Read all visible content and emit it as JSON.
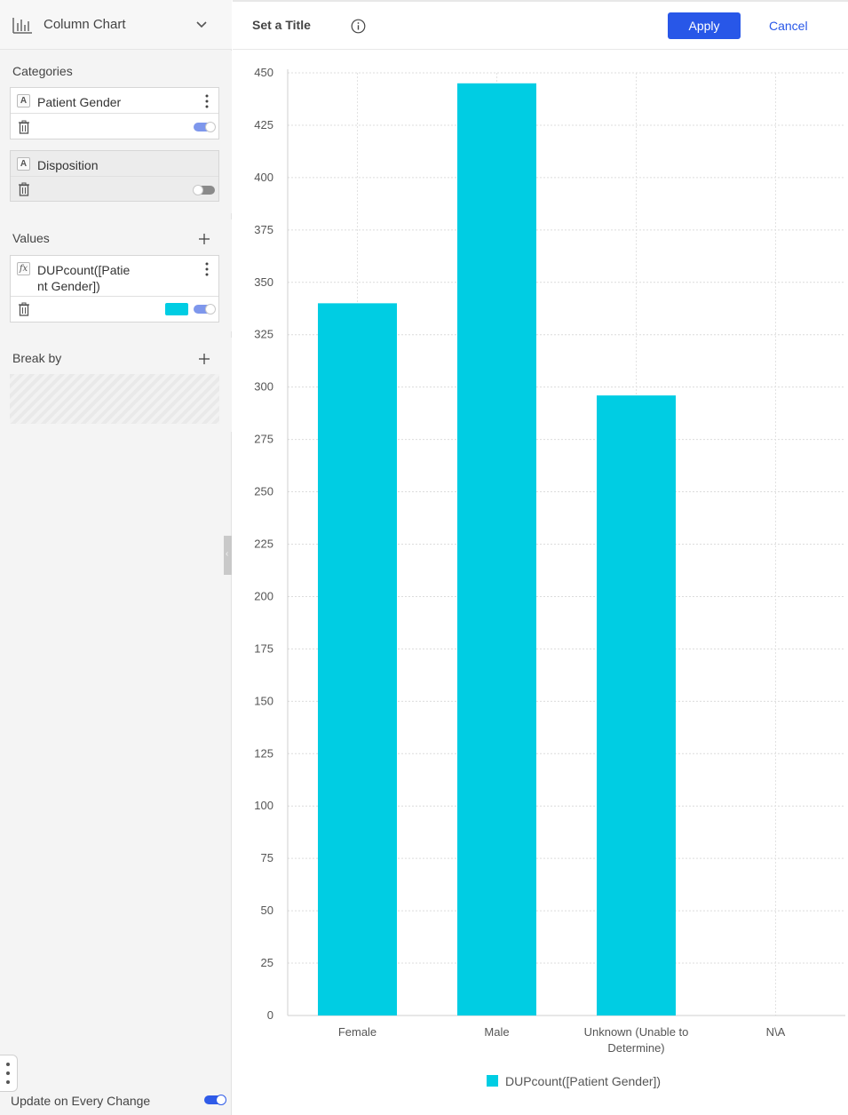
{
  "colors": {
    "accent": "#2857e8",
    "series": "#00cde3",
    "toggle_on": "#7e97ec"
  },
  "chart_type": {
    "label": "Column Chart",
    "icon": "column-chart-icon"
  },
  "categories_section": {
    "title": "Categories",
    "fields": [
      {
        "name": "Patient Gender",
        "type_badge": "A",
        "enabled": true
      },
      {
        "name": "Disposition",
        "type_badge": "A",
        "enabled": false
      }
    ]
  },
  "values_section": {
    "title": "Values",
    "fields": [
      {
        "name_line1": "DUPcount([Patie",
        "name_line2": "nt Gender])",
        "type_badge": "fx",
        "enabled": true
      }
    ]
  },
  "breakby_section": {
    "title": "Break by"
  },
  "footer": {
    "update_label": "Update on Every Change",
    "update_enabled": true
  },
  "top_bar": {
    "title": "Set a Title",
    "apply_label": "Apply",
    "cancel_label": "Cancel"
  },
  "chart_data": {
    "type": "bar",
    "categories": [
      "Female",
      "Male",
      "Unknown (Unable to Determine)",
      "N\\A"
    ],
    "category_label_lines": [
      [
        "Female"
      ],
      [
        "Male"
      ],
      [
        "Unknown (Unable to",
        "Determine)"
      ],
      [
        "N\\A"
      ]
    ],
    "series": [
      {
        "name": "DUPcount([Patient Gender])",
        "values": [
          340,
          445,
          296,
          0
        ]
      }
    ],
    "ylim": [
      0,
      450
    ],
    "yticks": [
      0,
      25,
      50,
      75,
      100,
      125,
      150,
      175,
      200,
      225,
      250,
      275,
      300,
      325,
      350,
      375,
      400,
      425,
      450
    ],
    "grid": true,
    "legend_position": "bottom",
    "title": "",
    "xlabel": "",
    "ylabel": ""
  }
}
